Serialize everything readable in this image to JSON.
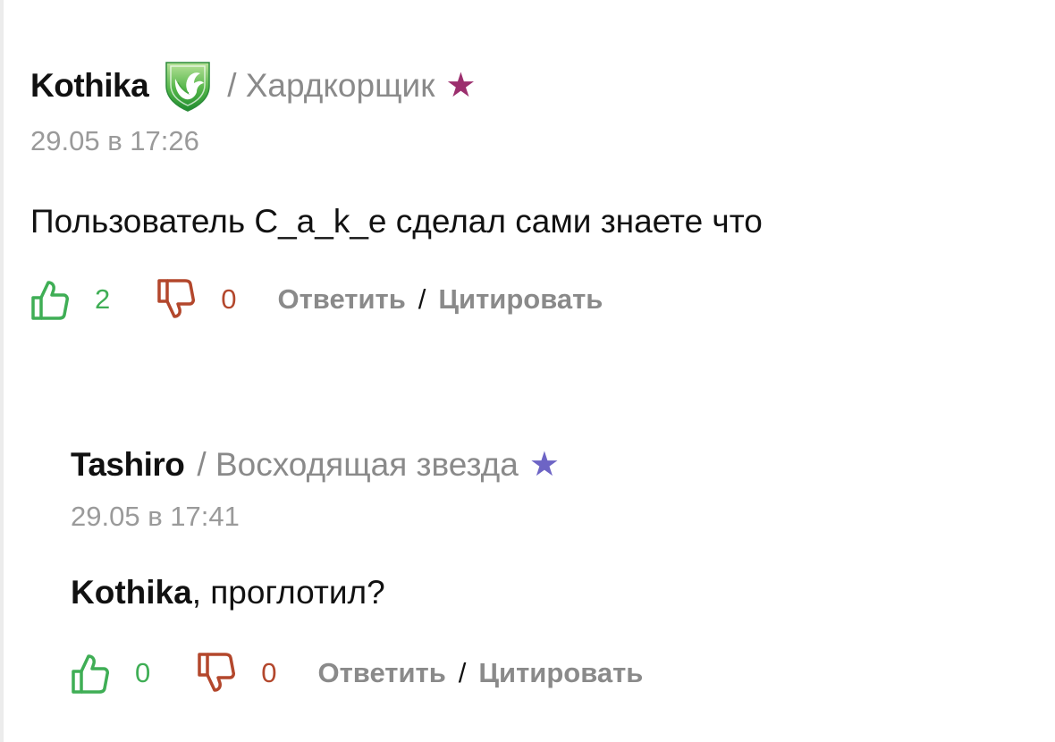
{
  "comments": [
    {
      "author": "Kothika",
      "rank": "/ Хардкорщик",
      "star": "★",
      "star_color": "#9c2f6e",
      "badge_icon": "green-shield-bird-badge",
      "date": "29.05 в 17:26",
      "text": "Пользователь C_a_k_e сделал сами знаете что",
      "likes": "2",
      "dislikes": "0",
      "reply_label": "Ответить",
      "separator": "/",
      "quote_label": "Цитировать"
    },
    {
      "author": "Tashiro",
      "rank": "/ Восходящая звезда",
      "star": "★",
      "star_color": "#6d64c5",
      "date": "29.05 в 17:41",
      "mention": "Kothika",
      "text": ", проглотил?",
      "likes": "0",
      "dislikes": "0",
      "reply_label": "Ответить",
      "separator": "/",
      "quote_label": "Цитировать"
    }
  ],
  "colors": {
    "like": "#3fae55",
    "dislike": "#b3472c",
    "muted": "#8a8a8a"
  }
}
